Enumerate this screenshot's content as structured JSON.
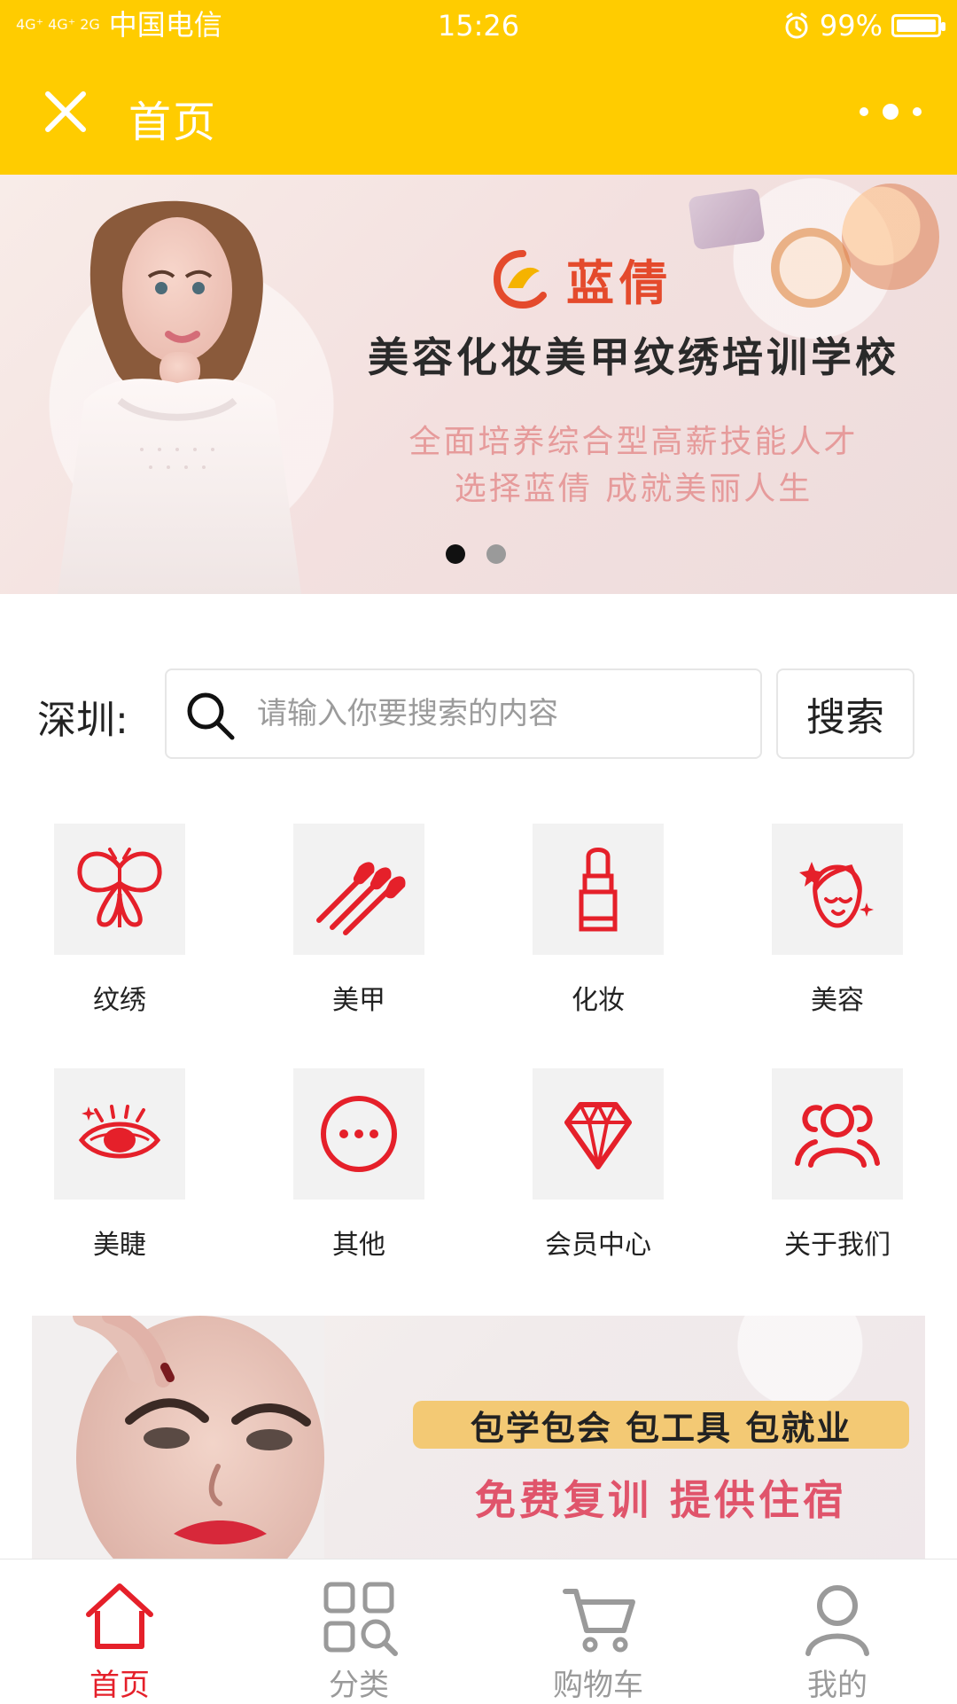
{
  "status_bar": {
    "network": "4G⁺ 4G⁺ 2G",
    "carrier": "中国电信",
    "time": "15:26",
    "battery": "99%",
    "battery_level": 0.99
  },
  "app_bar": {
    "title": "首页",
    "close_icon": "close-icon",
    "more_icon": "more-dots-icon"
  },
  "banner": {
    "brand": "蓝倩",
    "title": "美容化妆美甲纹绣培训学校",
    "subtitle_1": "全面培养综合型高薪技能人才",
    "subtitle_2": "选择蓝倩 成就美丽人生",
    "active_page": 1,
    "page_count": 2
  },
  "search": {
    "city_label": "深圳:",
    "placeholder": "请输入你要搜索的内容",
    "button_label": "搜索"
  },
  "categories": [
    {
      "label": "纹绣",
      "icon": "butterfly-icon"
    },
    {
      "label": "美甲",
      "icon": "nails-icon"
    },
    {
      "label": "化妆",
      "icon": "lipstick-icon"
    },
    {
      "label": "美容",
      "icon": "face-icon"
    },
    {
      "label": "美睫",
      "icon": "eyelash-icon"
    },
    {
      "label": "其他",
      "icon": "more-circle-icon"
    },
    {
      "label": "会员中心",
      "icon": "diamond-icon"
    },
    {
      "label": "关于我们",
      "icon": "users-icon"
    }
  ],
  "promo": {
    "line_1": "包学包会  包工具  包就业",
    "line_2": "免费复训 提供住宿"
  },
  "tabbar": {
    "items": [
      {
        "label": "首页",
        "icon": "home-icon",
        "active": true
      },
      {
        "label": "分类",
        "icon": "category-search-icon",
        "active": false
      },
      {
        "label": "购物车",
        "icon": "cart-icon",
        "active": false
      },
      {
        "label": "我的",
        "icon": "user-icon",
        "active": false
      }
    ]
  },
  "colors": {
    "brand_yellow": "#FFCC00",
    "accent_red": "#E5202A",
    "icon_bg": "#F2F2F2",
    "text_dark": "#222222",
    "text_gray": "#9A9A9A"
  }
}
